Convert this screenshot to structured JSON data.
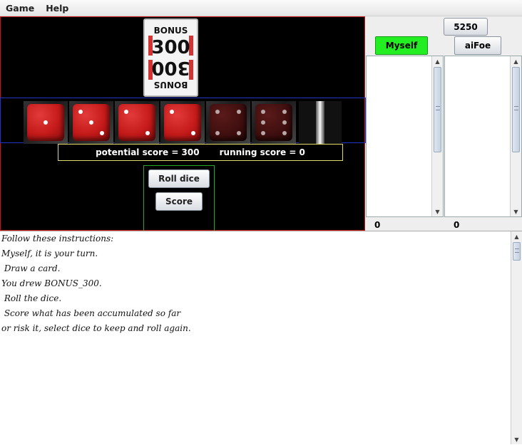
{
  "menu": {
    "items": [
      "Game",
      "Help"
    ]
  },
  "card": {
    "name": "BONUS_300",
    "top_word": "BONUS",
    "top_value": "300",
    "bottom_word": "BONUS",
    "bottom_value": "300",
    "stripe_color": "#d33333"
  },
  "dice": [
    {
      "value": 1,
      "state": "active"
    },
    {
      "value": 3,
      "state": "active"
    },
    {
      "value": 2,
      "state": "active"
    },
    {
      "value": 2,
      "state": "active"
    },
    {
      "value": 4,
      "state": "kept"
    },
    {
      "value": 6,
      "state": "kept"
    }
  ],
  "scores": {
    "potential": "potential score = 300",
    "running": "running score = 0"
  },
  "buttons": {
    "roll": "Roll dice",
    "score": "Score"
  },
  "target_score": "5250",
  "players": [
    {
      "name": "Myself",
      "active": true,
      "total": "0",
      "color": "#22ee22"
    },
    {
      "name": "aiFoe",
      "active": false,
      "total": "0"
    }
  ],
  "log": [
    "Follow these instructions:",
    "Myself, it is your turn.",
    " Draw a card.",
    "You drew BONUS_300.",
    " Roll the dice.",
    " Score what has been accumulated so far",
    "or risk it, select dice to keep and roll again."
  ]
}
